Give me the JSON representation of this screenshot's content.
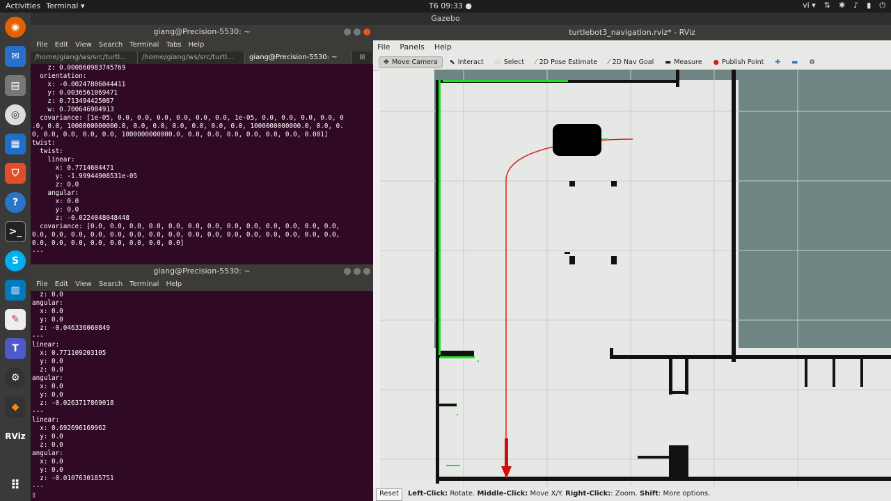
{
  "topbar": {
    "activities": "Activities",
    "app_menu": "Terminal ▾",
    "clock": "T6 09:33 ●",
    "lang": "vi ▾"
  },
  "gazebo": {
    "title": "Gazebo"
  },
  "term1": {
    "title": "giang@Precision-5530: ~",
    "menu": [
      "File",
      "Edit",
      "View",
      "Search",
      "Terminal",
      "Tabs",
      "Help"
    ],
    "tabs": [
      "/home/giang/ws/src/turtl...",
      "/home/giang/ws/src/turtl...",
      "giang@Precision-5530: ~"
    ],
    "output": "    z: 0.000860983745769\n  orientation:\n    x: -0.00247806044411\n    y: 0.0036561069471\n    z: 0.713494425087\n    w: 0.700646984913\n  covariance: [1e-05, 0.0, 0.0, 0.0, 0.0, 0.0, 0.0, 1e-05, 0.0, 0.0, 0.0, 0.0, 0\n.0, 0.0, 1000000000000.0, 0.0, 0.0, 0.0, 0.0, 0.0, 0.0, 1000000000000.0, 0.0, 0.\n0, 0.0, 0.0, 0.0, 0.0, 1000000000000.0, 0.0, 0.0, 0.0, 0.0, 0.0, 0.0, 0.001]\ntwist:\n  twist:\n    linear:\n      x: 0.7714604471\n      y: -1.99944908531e-05\n      z: 0.0\n    angular:\n      x: 0.0\n      y: 0.0\n      z: -0.0224048048448\n  covariance: [0.0, 0.0, 0.0, 0.0, 0.0, 0.0, 0.0, 0.0, 0.0, 0.0, 0.0, 0.0, 0.0,\n0.0, 0.0, 0.0, 0.0, 0.0, 0.0, 0.0, 0.0, 0.0, 0.0, 0.0, 0.0, 0.0, 0.0, 0.0, 0.0,\n0.0, 0.0, 0.0, 0.0, 0.0, 0.0, 0.0, 0.0]\n---"
  },
  "term2": {
    "title": "giang@Precision-5530: ~",
    "menu": [
      "File",
      "Edit",
      "View",
      "Search",
      "Terminal",
      "Help"
    ],
    "output": "  z: 0.0\nangular:\n  x: 0.0\n  y: 0.0\n  z: -0.046336060849\n---\nlinear:\n  x: 0.771109203105\n  y: 0.0\n  z: 0.0\nangular:\n  x: 0.0\n  y: 0.0\n  z: -0.0263717869018\n---\nlinear:\n  x: 0.692696169962\n  y: 0.0\n  z: 0.0\nangular:\n  x: 0.0\n  y: 0.0\n  z: -0.0107630185751\n---\n▯"
  },
  "rviz": {
    "title": "turtlebot3_navigation.rviz* - RViz",
    "menu": [
      "File",
      "Panels",
      "Help"
    ],
    "tools": [
      "Move Camera",
      "Interact",
      "Select",
      "2D Pose Estimate",
      "2D Nav Goal",
      "Measure",
      "Publish Point"
    ],
    "status": {
      "reset": "Reset",
      "left": "Left-Click:",
      "left_action": "Rotate.",
      "middle": "Middle-Click:",
      "middle_action": "Move X/Y.",
      "right": "Right-Click:",
      "right_action": ": Zoom.",
      "shift": "Shift",
      "shift_action": ": More options."
    }
  },
  "colors": {
    "terminal_bg": "#300a24",
    "map_free": "#e6e8e6",
    "map_unknown": "#6f8583",
    "laser": "#1fe01f",
    "path": "#e02020"
  }
}
